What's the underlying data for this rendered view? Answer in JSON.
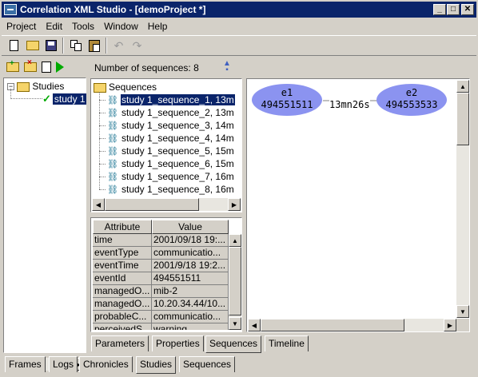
{
  "window": {
    "title": "Correlation XML Studio - [demoProject *]"
  },
  "menu": [
    "Project",
    "Edit",
    "Tools",
    "Window",
    "Help"
  ],
  "toolbar": {
    "icons": [
      "new-file-icon",
      "open-folder-icon",
      "save-icon",
      "copy-icon",
      "paste-icon",
      "undo-icon",
      "redo-icon"
    ]
  },
  "left_panel": {
    "tree": {
      "root": "Studies",
      "child": "study 1"
    }
  },
  "sequences_panel": {
    "count_label": "Number of sequences: 8",
    "root": "Sequences",
    "items": [
      "study 1_sequence_1, 13m",
      "study 1_sequence_2, 13m",
      "study 1_sequence_3, 14m",
      "study 1_sequence_4, 14m",
      "study 1_sequence_5, 15m",
      "study 1_sequence_6, 15m",
      "study 1_sequence_7, 16m",
      "study 1_sequence_8, 16m"
    ]
  },
  "attributes": {
    "headers": [
      "Attribute",
      "Value"
    ],
    "rows": [
      [
        "time",
        "2001/09/18 19:..."
      ],
      [
        "eventType",
        "communicatio..."
      ],
      [
        "eventTime",
        "2001/9/18 19:2..."
      ],
      [
        "eventId",
        "494551511"
      ],
      [
        "managedO...",
        "mib-2"
      ],
      [
        "managedO...",
        "10.20.34.44/10..."
      ],
      [
        "probableC...",
        "communicatio..."
      ],
      [
        "perceivedS...",
        "warning"
      ]
    ]
  },
  "graph": {
    "nodes": [
      {
        "label": "e1",
        "id": "494551511"
      },
      {
        "label": "e2",
        "id": "494553533"
      }
    ],
    "edge_label": "13mn26s",
    "node_color": "#8b93f0"
  },
  "inner_tabs": [
    "Parameters",
    "Properties",
    "Sequences",
    "Timeline"
  ],
  "inner_tab_active": "Sequences",
  "bottom_tabs": [
    "Frames",
    "Logs",
    "Chronicles",
    "Studies",
    "Sequences"
  ],
  "bottom_tab_active": "Studies",
  "colors": {
    "titlebar": "#0a246a",
    "selection": "#0a246a",
    "face": "#d4d0c8"
  }
}
